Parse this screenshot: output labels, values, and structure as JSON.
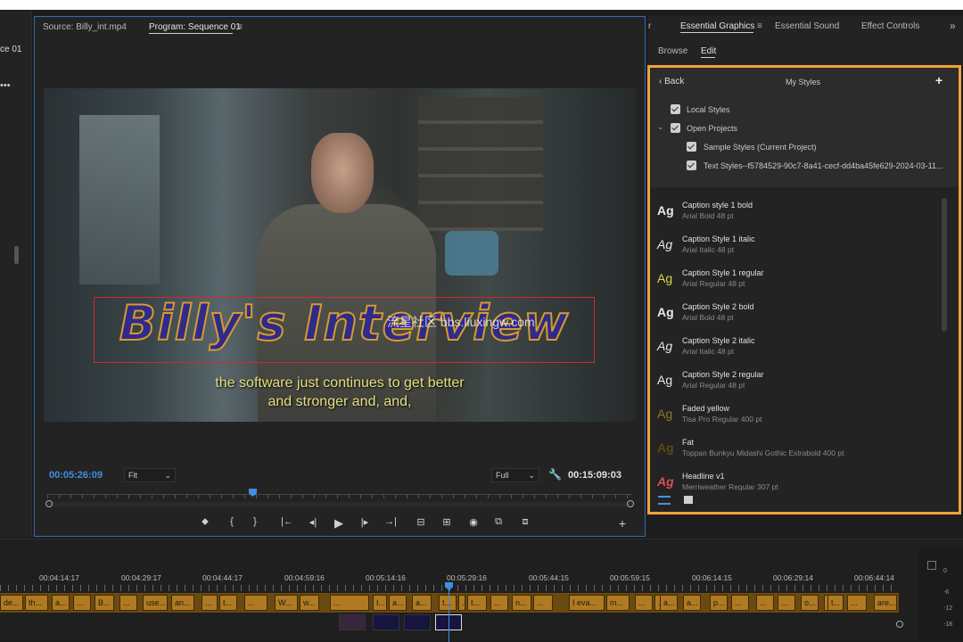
{
  "left_panel": {
    "tab_label": "ce 01",
    "menu_dots": "•••"
  },
  "program_monitor": {
    "source_tab": "Source: Billy_int.mp4",
    "program_tab": "Program: Sequence 01",
    "menu_icon": "≡",
    "current_timecode": "00:05:26:09",
    "duration_timecode": "00:15:09:03",
    "zoom_value": "Fit",
    "resolution_value": "Full",
    "title_text": "Billy's Interview",
    "subtitle_line1": "the software just continues to get better",
    "subtitle_line2": "and stronger and, and,",
    "watermark": "流星社区 bbs.liuxingw.com",
    "controls": [
      "⬥",
      "{",
      "}",
      "|←",
      "◂|",
      "▶",
      "|▸",
      "→|",
      "⊟",
      "⊞",
      "◉",
      "⧉",
      "⧈",
      "+"
    ],
    "colors": {
      "accent": "#3f8fe0",
      "title_fill": "#2e2b8c",
      "title_stroke": "#d79a2c",
      "subtitle": "#e2e07a"
    }
  },
  "essential_graphics": {
    "tabs": [
      "Essential Graphics",
      "Essential Sound",
      "Effect Controls"
    ],
    "tab_prefix": "r",
    "overflow": "»",
    "subtabs": [
      "Browse",
      "Edit"
    ],
    "back_label": "Back",
    "panel_title": "My Styles",
    "add_label": "+",
    "checks": [
      {
        "label": "Local Styles"
      },
      {
        "label": "Open Projects"
      },
      {
        "label": "Sample Styles (Current Project)"
      },
      {
        "label": "Text Styles--f5784529-90c7-8a41-cecf-dd4ba45fe629-2024-03-11..."
      }
    ],
    "styles": [
      {
        "ag": "Ag",
        "name": "Caption style 1 bold",
        "sub": "Arial Bold 48 pt",
        "color": "#e8e8e8"
      },
      {
        "ag": "Ag",
        "name": "Caption Style 1 italic",
        "sub": "Arial Italic 48 pt",
        "color": "#e8e8e8"
      },
      {
        "ag": "Ag",
        "name": "Caption Style 1 regular",
        "sub": "Arial Regular 48 pt",
        "color": "#d8d84a"
      },
      {
        "ag": "Ag",
        "name": "Caption Style 2 bold",
        "sub": "Arial Bold 48 pt",
        "color": "#e8e8e8"
      },
      {
        "ag": "Ag",
        "name": "Caption Style 2 italic",
        "sub": "Arial Italic 48 pt",
        "color": "#e8e8e8"
      },
      {
        "ag": "Ag",
        "name": "Caption Style 2 regular",
        "sub": "Arial Regular 48 pt",
        "color": "#e8e8e8"
      },
      {
        "ag": "Ag",
        "name": "Faded yellow",
        "sub": "Tisa Pro Regular 400 pt",
        "color": "#8a7a2a"
      },
      {
        "ag": "Ag",
        "name": "Fat",
        "sub": "Toppan Bunkyu Midashi Gothic Extrabold 400 pt",
        "color": "#5a4a10"
      },
      {
        "ag": "Ag",
        "name": "Headline v1",
        "sub": "Merriweather Regular 307 pt",
        "color": "#d85050"
      }
    ],
    "accent": "#f0a23b"
  },
  "timeline": {
    "times": [
      "00:04:14:17",
      "00:04:29:17",
      "00:04:44:17",
      "00:04:59:16",
      "00:05:14:16",
      "00:05:29:16",
      "00:05:44:15",
      "00:05:59:15",
      "00:06:14:15",
      "00:06:29:14",
      "00:06:44:14"
    ],
    "captions": [
      "de...",
      "th...",
      "a...",
      "...",
      "B...",
      "...",
      "use...",
      "an...",
      "...",
      "t...",
      "...",
      "W...",
      "w...",
      "...",
      "I...",
      "a...",
      "a...",
      "t...",
      "...",
      "t...",
      "...",
      "n...",
      "...",
      "I eva...",
      "m...",
      "...",
      "...",
      "a...",
      "a...",
      "p...",
      "...",
      "...",
      "...",
      "o...",
      "...",
      "t...",
      "...",
      "are..."
    ],
    "meter_labels": [
      "0",
      "-6",
      "-12",
      "-18"
    ]
  }
}
